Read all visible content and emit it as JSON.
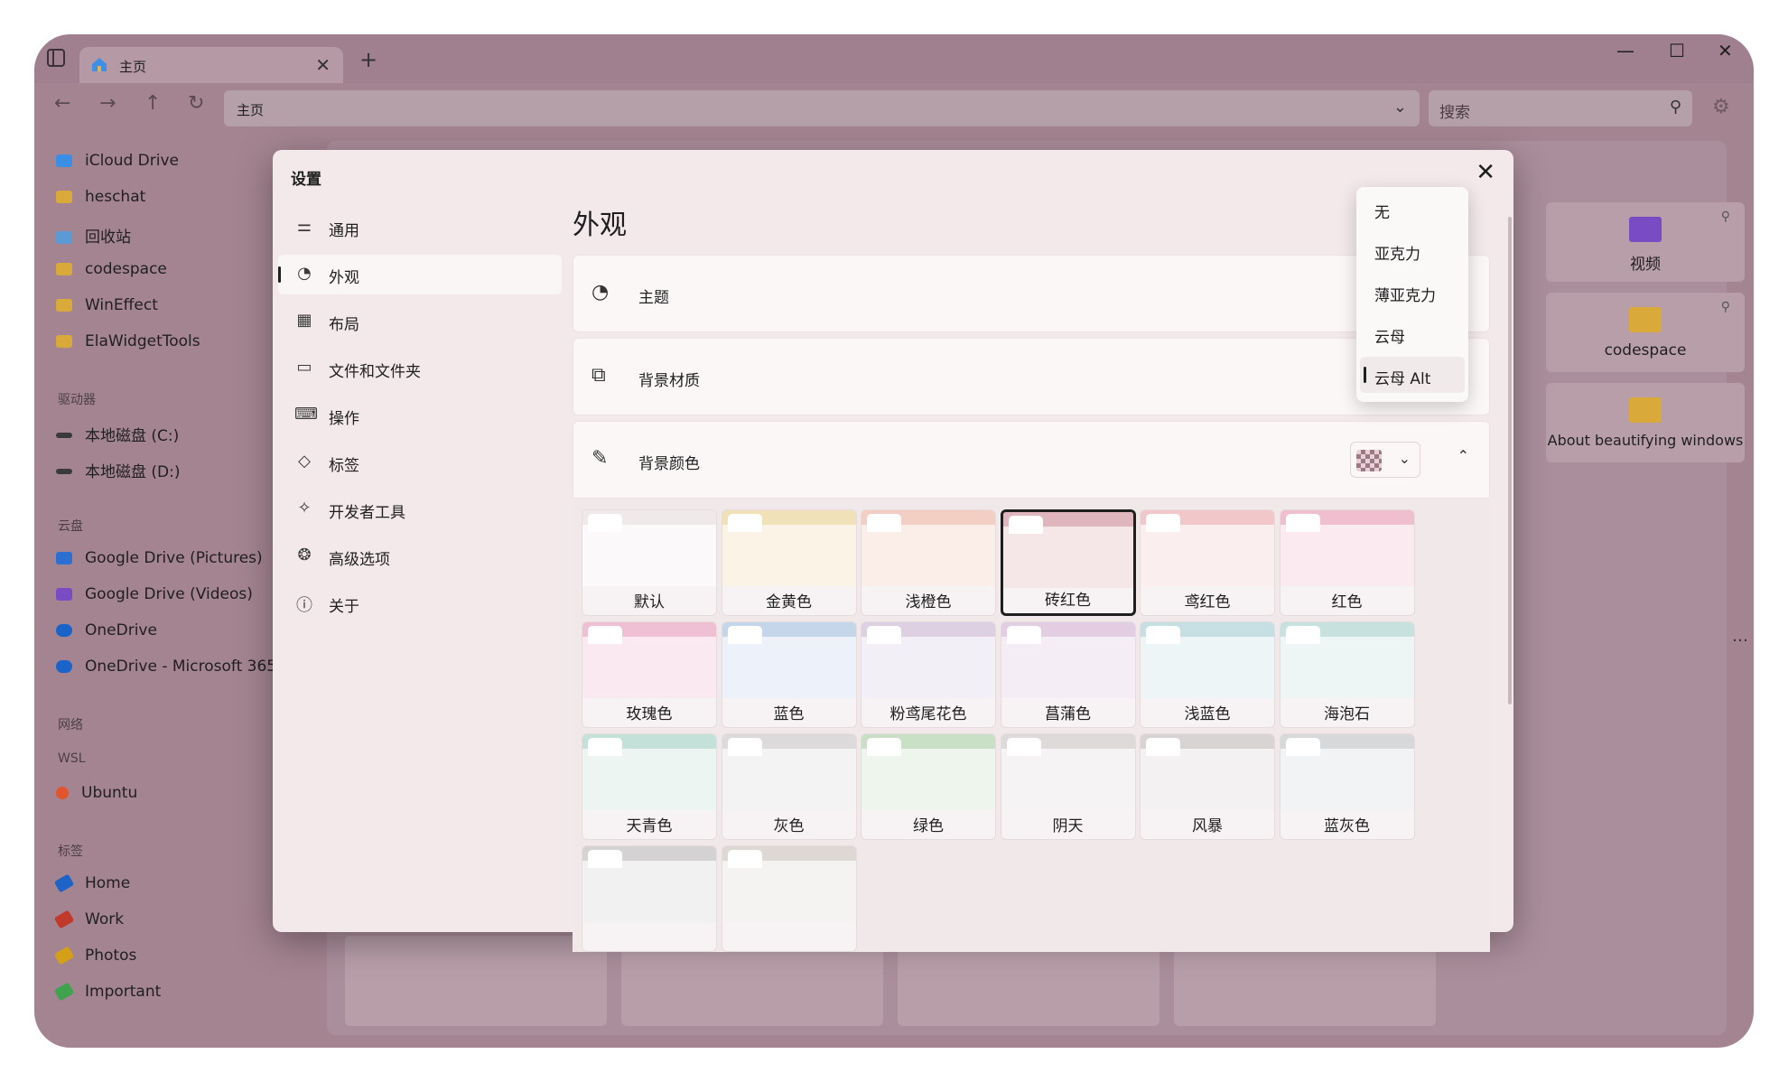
{
  "window": {
    "tab_title": "主页",
    "tab_close": "✕",
    "new_tab": "+",
    "minimize": "—",
    "maximize": "☐",
    "close": "✕"
  },
  "navbar": {
    "address": "主页",
    "search_placeholder": "搜索"
  },
  "left_pane": {
    "favorites": [
      {
        "label": "iCloud Drive",
        "color": "#3a8ee6"
      },
      {
        "label": "heschat",
        "color": "#d9a93a"
      },
      {
        "label": "回收站",
        "color": "#5a9bd5"
      },
      {
        "label": "codespace",
        "color": "#d9a93a"
      },
      {
        "label": "WinEffect",
        "color": "#d9a93a"
      },
      {
        "label": "ElaWidgetTools",
        "color": "#d9a93a"
      }
    ],
    "drives_header": "驱动器",
    "drives": [
      {
        "label": "本地磁盘 (C:)"
      },
      {
        "label": "本地磁盘 (D:)"
      }
    ],
    "cloud_header": "云盘",
    "cloud": [
      {
        "label": "Google Drive (Pictures)",
        "color": "#2a6fd1"
      },
      {
        "label": "Google Drive (Videos)",
        "color": "#7a4cc4"
      },
      {
        "label": "OneDrive",
        "color": "#1a64c9"
      },
      {
        "label": "OneDrive - Microsoft 365",
        "color": "#1a64c9"
      }
    ],
    "network_header": "网络",
    "wsl_header": "WSL",
    "wsl": [
      {
        "label": "Ubuntu",
        "color": "#e2542c"
      }
    ],
    "tags_header": "标签",
    "tags": [
      {
        "label": "Home",
        "color": "#1f63c6"
      },
      {
        "label": "Work",
        "color": "#c0392b"
      },
      {
        "label": "Photos",
        "color": "#d4a017"
      },
      {
        "label": "Important",
        "color": "#3fa34d"
      }
    ]
  },
  "background_cards": [
    {
      "label": "视频"
    },
    {
      "label": "codespace"
    },
    {
      "label": "About beautifying windows"
    }
  ],
  "background_more": "…",
  "settings": {
    "title": "设置",
    "close": "✕",
    "nav": [
      {
        "label": "通用",
        "icon": "sliders-icon",
        "glyph": "⚌"
      },
      {
        "label": "外观",
        "icon": "palette-icon",
        "glyph": "◔",
        "active": true
      },
      {
        "label": "布局",
        "icon": "grid-icon",
        "glyph": "▦"
      },
      {
        "label": "文件和文件夹",
        "icon": "folder-icon",
        "glyph": "▭"
      },
      {
        "label": "操作",
        "icon": "keyboard-icon",
        "glyph": "⌨"
      },
      {
        "label": "标签",
        "icon": "tag-icon",
        "glyph": "◇"
      },
      {
        "label": "开发者工具",
        "icon": "devtools-icon",
        "glyph": "✧"
      },
      {
        "label": "高级选项",
        "icon": "advanced-icon",
        "glyph": "❂"
      },
      {
        "label": "关于",
        "icon": "info-icon",
        "glyph": "ⓘ"
      }
    ],
    "section_title": "外观",
    "rows": {
      "theme": "主题",
      "material": "背景材质",
      "color": "背景颜色"
    },
    "color_tiles": [
      {
        "label": "默认",
        "top": "#efe9ea",
        "body": "#fbf9f9"
      },
      {
        "label": "金黄色",
        "top": "#f1e1b8",
        "body": "#fbf4e6"
      },
      {
        "label": "浅橙色",
        "top": "#f2cfc2",
        "body": "#fbeee9"
      },
      {
        "label": "砖红色",
        "top": "#dfb6be",
        "body": "#f5e6e8",
        "selected": true
      },
      {
        "label": "鸢红色",
        "top": "#f1c7c9",
        "body": "#fbeeee"
      },
      {
        "label": "红色",
        "top": "#efbfd0",
        "body": "#fbeaf0"
      },
      {
        "label": "玫瑰色",
        "top": "#efc0d4",
        "body": "#fbe9f1"
      },
      {
        "label": "蓝色",
        "top": "#c6d6ea",
        "body": "#edf1f9"
      },
      {
        "label": "粉鸢尾花色",
        "top": "#dcd0e2",
        "body": "#f3eff6"
      },
      {
        "label": "菖蒲色",
        "top": "#e2cde3",
        "body": "#f5edf5"
      },
      {
        "label": "浅蓝色",
        "top": "#c6dfe2",
        "body": "#eef5f6"
      },
      {
        "label": "海泡石",
        "top": "#c6e1de",
        "body": "#edf6f4"
      },
      {
        "label": "天青色",
        "top": "#c3e1d8",
        "body": "#ecf5f2"
      },
      {
        "label": "灰色",
        "top": "#dcdada",
        "body": "#f4f3f3"
      },
      {
        "label": "绿色",
        "top": "#c9dfc6",
        "body": "#eef5ed"
      },
      {
        "label": "阴天",
        "top": "#dedada",
        "body": "#f5f3f3"
      },
      {
        "label": "风暴",
        "top": "#d8d4d4",
        "body": "#f3f1f1"
      },
      {
        "label": "蓝灰色",
        "top": "#d6d8da",
        "body": "#f2f3f4"
      },
      {
        "label": "",
        "top": "#d4d2d2",
        "body": "#f2f1f1"
      },
      {
        "label": "",
        "top": "#ddd8d4",
        "body": "#f5f3f1"
      }
    ]
  },
  "material_dropdown": {
    "options": [
      "无",
      "亚克力",
      "薄亚克力",
      "云母",
      "云母 Alt"
    ],
    "selected_index": 4
  }
}
